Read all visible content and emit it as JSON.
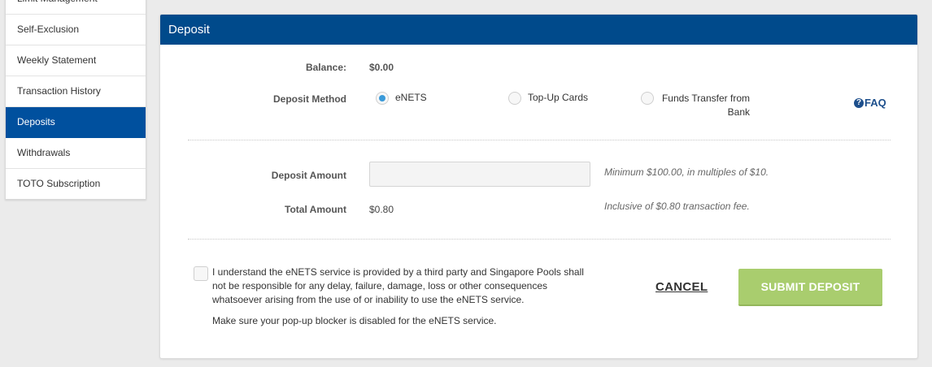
{
  "sidebar": {
    "items": [
      {
        "label": "Limit Management",
        "active": false
      },
      {
        "label": "Self-Exclusion",
        "active": false
      },
      {
        "label": "Weekly Statement",
        "active": false
      },
      {
        "label": "Transaction History",
        "active": false
      },
      {
        "label": "Deposits",
        "active": true
      },
      {
        "label": "Withdrawals",
        "active": false
      },
      {
        "label": "TOTO Subscription",
        "active": false
      }
    ]
  },
  "panel": {
    "title": "Deposit",
    "balance_label": "Balance:",
    "balance_value": "$0.00",
    "method_label": "Deposit Method",
    "methods": [
      {
        "label": "eNETS",
        "selected": true
      },
      {
        "label": "Top-Up Cards",
        "selected": false
      },
      {
        "label": "Funds Transfer from Bank",
        "selected": false
      }
    ],
    "faq_icon": "?",
    "faq_label": "FAQ",
    "amount_label": "Deposit Amount",
    "amount_value": "",
    "amount_hint": "Minimum $100.00, in multiples of $10.",
    "total_label": "Total Amount",
    "total_value": "$0.80",
    "total_hint": "Inclusive of $0.80 transaction fee.",
    "terms_text": "I understand the eNETS service is provided by a third party and Singapore Pools shall not be responsible for any delay, failure, damage, loss or other consequences whatsoever arising from the use of or inability to use the eNETS service.",
    "terms_checked": false,
    "popup_note": "Make sure your pop-up blocker is disabled for the eNETS service.",
    "cancel_label": "CANCEL",
    "submit_label": "SUBMIT DEPOSIT"
  },
  "colors": {
    "header_bg": "#004a8b",
    "active_nav": "#00509e",
    "submit_bg": "#a9cd6e",
    "radio_selected": "#3a9ad9",
    "faq": "#1d4f8c"
  }
}
